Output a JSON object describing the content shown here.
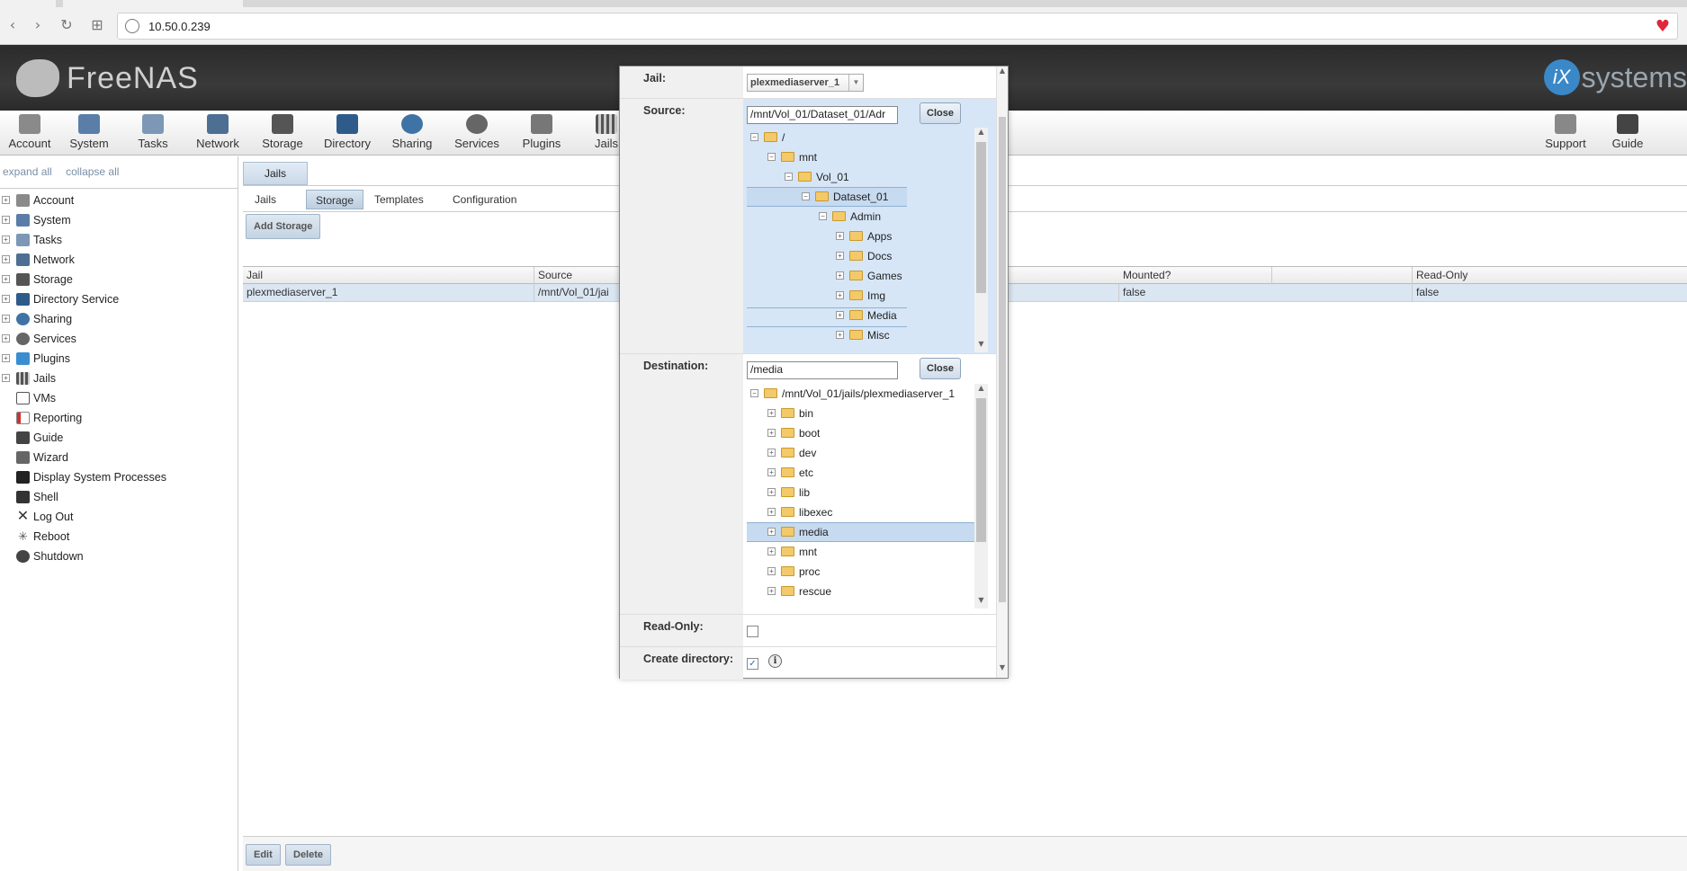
{
  "browser": {
    "url": "10.50.0.239"
  },
  "header": {
    "logo_text": "FreeNAS",
    "brand_text": "systems",
    "brand_mark": "iX"
  },
  "toolbar": {
    "items": [
      "Account",
      "System",
      "Tasks",
      "Network",
      "Storage",
      "Directory",
      "Sharing",
      "Services",
      "Plugins",
      "Jails"
    ],
    "right_items": [
      "Support",
      "Guide"
    ]
  },
  "sidebar": {
    "expand_all": "expand all",
    "collapse_all": "collapse all",
    "items": [
      "Account",
      "System",
      "Tasks",
      "Network",
      "Storage",
      "Directory Service",
      "Sharing",
      "Services",
      "Plugins",
      "Jails",
      "VMs",
      "Reporting",
      "Guide",
      "Wizard",
      "Display System Processes",
      "Shell",
      "Log Out",
      "Reboot",
      "Shutdown"
    ]
  },
  "main": {
    "top_tab": "Jails",
    "sub_tabs": [
      "Jails",
      "Storage",
      "Templates",
      "Configuration"
    ],
    "active_sub_tab": "Storage",
    "add_button": "Add Storage",
    "columns": [
      "Jail",
      "Source",
      "Mounted?",
      "Read-Only"
    ],
    "rows": [
      {
        "jail": "plexmediaserver_1",
        "source": "/mnt/Vol_01/jai",
        "mounted": "false",
        "readonly": "false"
      }
    ],
    "edit_button": "Edit",
    "delete_button": "Delete"
  },
  "dialog": {
    "jail_label": "Jail:",
    "jail_value": "plexmediaserver_1",
    "source_label": "Source:",
    "source_value": "/mnt/Vol_01/Dataset_01/Adr",
    "close_label": "Close",
    "source_tree": [
      {
        "label": "/",
        "level": 0,
        "open": true
      },
      {
        "label": "mnt",
        "level": 1,
        "open": true
      },
      {
        "label": "Vol_01",
        "level": 2,
        "open": true
      },
      {
        "label": "Dataset_01",
        "level": 3,
        "open": true,
        "selected": true
      },
      {
        "label": "Admin",
        "level": 4,
        "open": true
      },
      {
        "label": "Apps",
        "level": 5,
        "open": false
      },
      {
        "label": "Docs",
        "level": 5,
        "open": false
      },
      {
        "label": "Games",
        "level": 5,
        "open": false
      },
      {
        "label": "Img",
        "level": 5,
        "open": false
      },
      {
        "label": "Media",
        "level": 5,
        "open": false,
        "hover": true
      },
      {
        "label": "Misc",
        "level": 5,
        "open": false
      }
    ],
    "destination_label": "Destination:",
    "destination_value": "/media",
    "dest_tree": [
      {
        "label": "/mnt/Vol_01/jails/plexmediaserver_1",
        "level": 0,
        "open": true
      },
      {
        "label": "bin",
        "level": 1,
        "open": false
      },
      {
        "label": "boot",
        "level": 1,
        "open": false
      },
      {
        "label": "dev",
        "level": 1,
        "open": false
      },
      {
        "label": "etc",
        "level": 1,
        "open": false
      },
      {
        "label": "lib",
        "level": 1,
        "open": false
      },
      {
        "label": "libexec",
        "level": 1,
        "open": false
      },
      {
        "label": "media",
        "level": 1,
        "open": false,
        "selected": true
      },
      {
        "label": "mnt",
        "level": 1,
        "open": false
      },
      {
        "label": "proc",
        "level": 1,
        "open": false
      },
      {
        "label": "rescue",
        "level": 1,
        "open": false
      }
    ],
    "readonly_label": "Read-Only:",
    "readonly_checked": false,
    "create_dir_label": "Create directory:",
    "create_dir_checked": true,
    "info_glyph": "i"
  }
}
